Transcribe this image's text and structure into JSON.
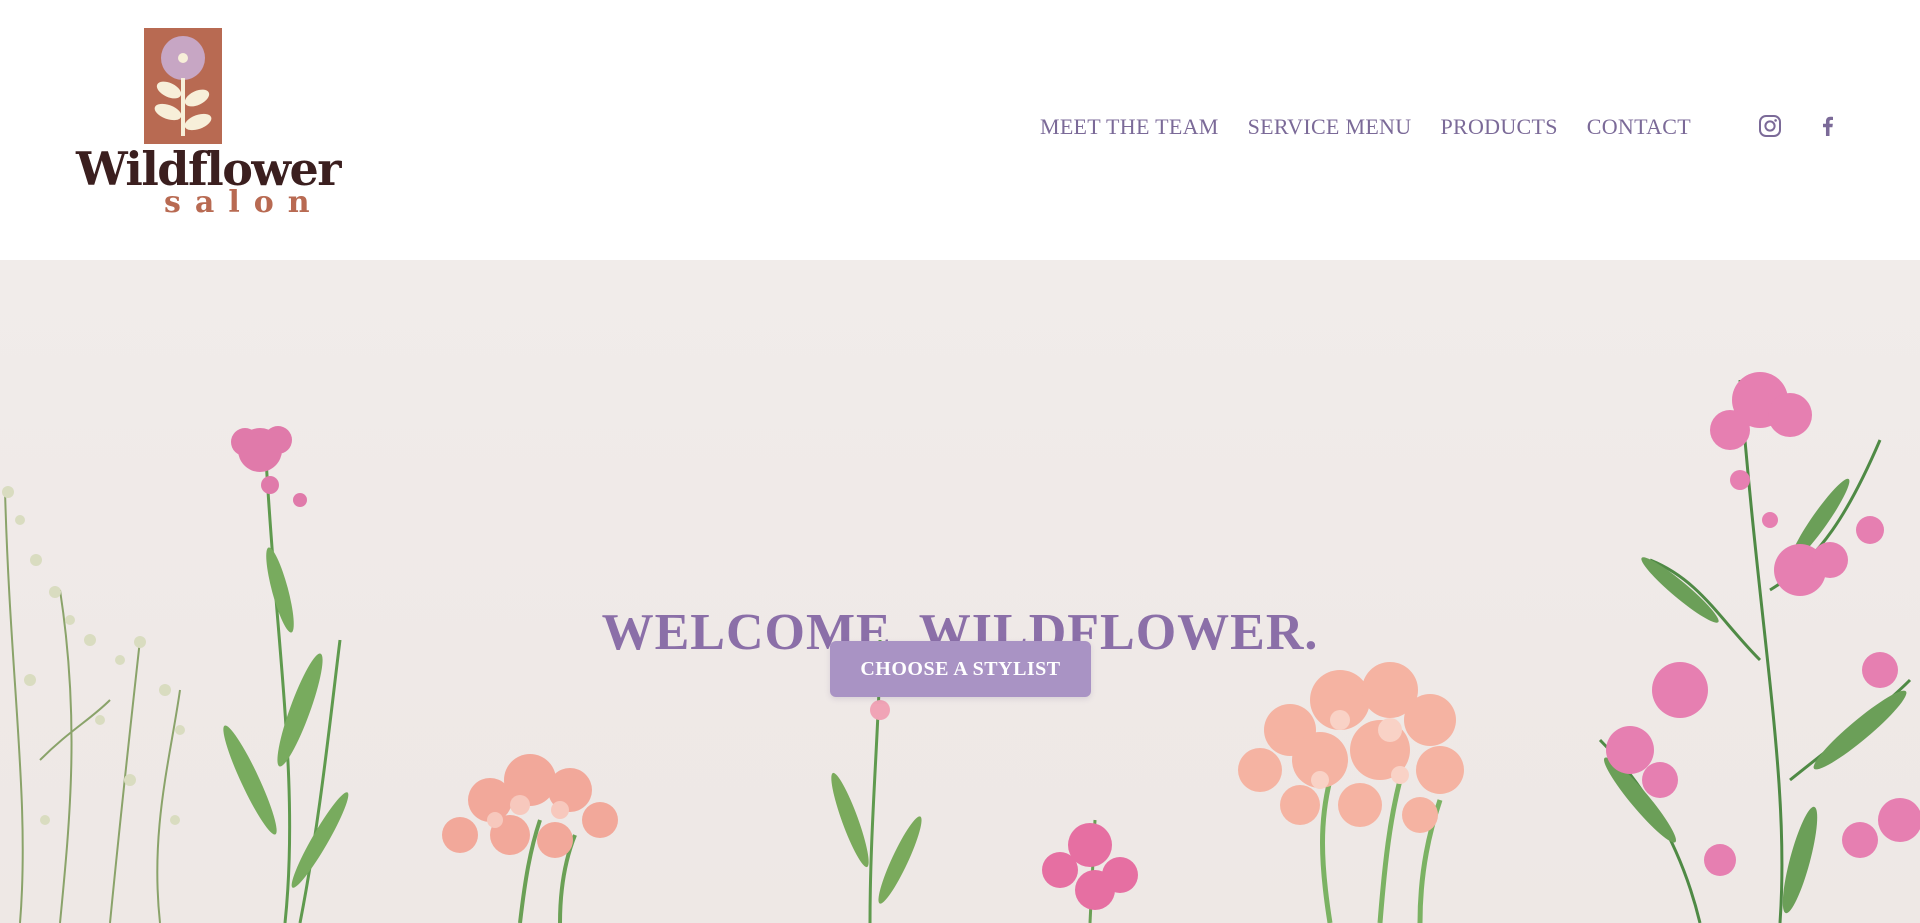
{
  "brand": {
    "name": "Wildflower",
    "sub": "salon",
    "colors": {
      "terracotta": "#b86a52",
      "dark": "#3b1f1f",
      "lavender": "#a993c4",
      "nav": "#7b6a98",
      "title": "#8b6fa8"
    }
  },
  "nav": {
    "items": [
      {
        "label": "MEET THE TEAM"
      },
      {
        "label": "SERVICE MENU"
      },
      {
        "label": "PRODUCTS"
      },
      {
        "label": "CONTACT"
      }
    ]
  },
  "social": {
    "icons": [
      "instagram-icon",
      "facebook-icon"
    ]
  },
  "hero": {
    "title": "WELCOME, WILDFLOWER.",
    "cta_label": "CHOOSE A STYLIST"
  }
}
